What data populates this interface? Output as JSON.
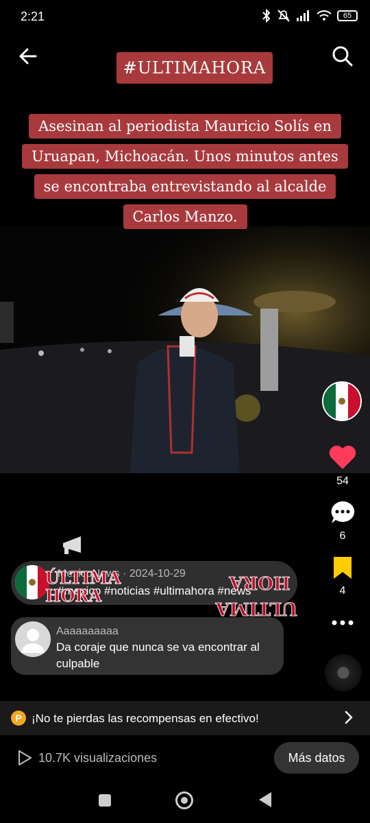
{
  "status": {
    "time": "2:21",
    "battery": "65"
  },
  "video": {
    "tag_banner": "#ULTIMAHORA",
    "headline": "Asesinan al periodista Mauricio Solís en Uruapan, Michoacán. Unos minutos antes se encontraba entrevistando al alcalde Carlos Manzo.",
    "watermark_left": "ÚLTIMA HORA",
    "watermark_right": "ULTIMA HORA"
  },
  "rail": {
    "likes": "54",
    "comments": "6",
    "saves": "4",
    "like_color": "#ff3b5c",
    "save_color": "#ffcc00"
  },
  "info": {
    "username": "MexicoNews",
    "date": "2024-10-29",
    "date_prefix": " · ",
    "hashtags": "#mexico #noticias #ultimahora #news"
  },
  "comment": {
    "username": "Aaaaaaaaaa",
    "text": "Da coraje que nunca se va encontrar al culpable"
  },
  "reward": {
    "coin_letter": "P",
    "text": "¡No te pierdas las recompensas en efectivo!"
  },
  "bottom": {
    "views": "10.7K visualizaciones",
    "more_button": "Más datos"
  },
  "colors": {
    "banner": "#a83a3d"
  }
}
